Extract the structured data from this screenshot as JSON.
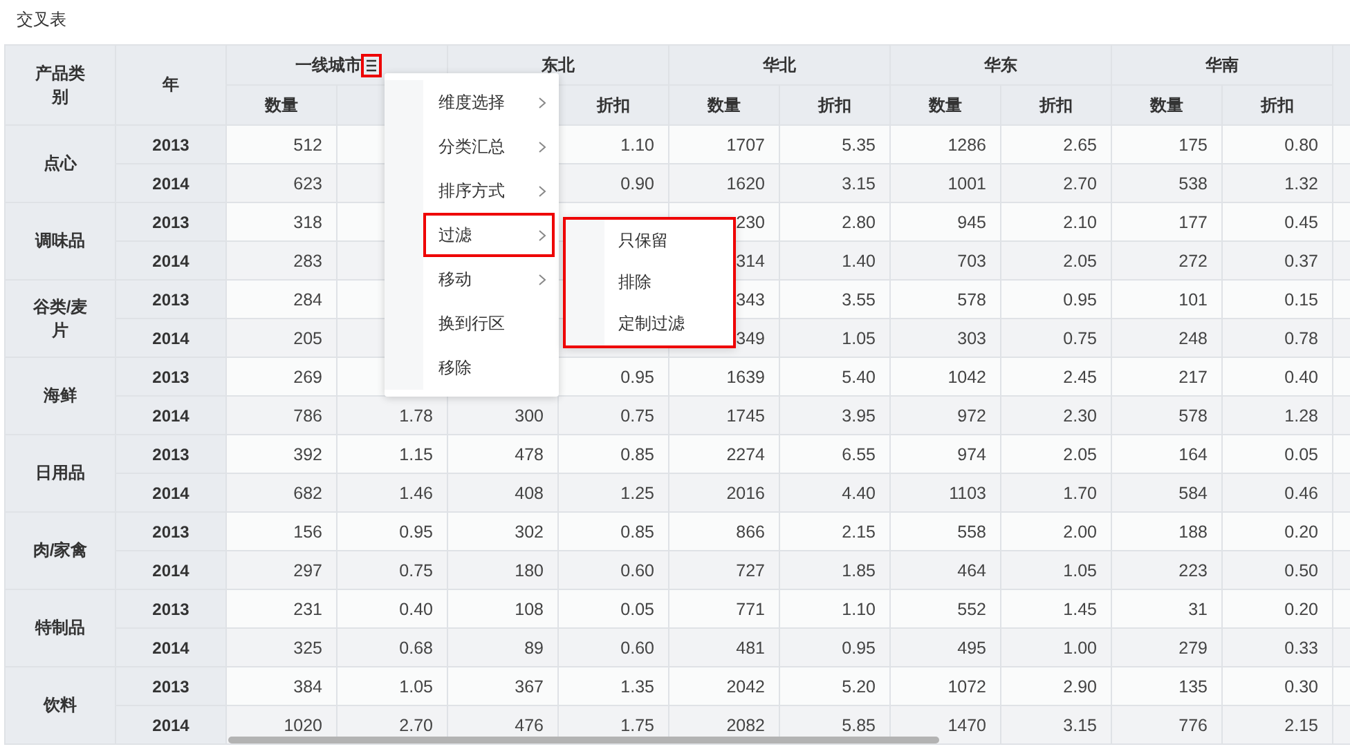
{
  "title": "交叉表",
  "table": {
    "corner_headers": [
      "产品类别",
      "年"
    ],
    "column_groups": [
      {
        "name": "一线城市",
        "menu_icon": {
          "highlighted": true
        },
        "subcolumns": {
          "quantity": "数量"
        }
      },
      {
        "name": "东北",
        "subcolumns": {
          "discount": "折扣"
        }
      },
      {
        "name": "华北",
        "subcolumns": {
          "quantity": "数量",
          "discount": "折扣"
        }
      },
      {
        "name": "华东",
        "subcolumns": {
          "quantity": "数量",
          "discount": "折扣"
        }
      },
      {
        "name": "华南",
        "subcolumns": {
          "quantity": "数量",
          "discount": "折扣"
        }
      }
    ],
    "rows": [
      {
        "category": "点心",
        "years": [
          {
            "year": "2013",
            "cells": {
              "column_1": "512",
              "column_4": "1.10",
              "column_5": "1707",
              "column_6": "5.35",
              "column_7": "1286",
              "column_8": "2.65",
              "column_9": "175",
              "column_10": "0.80"
            }
          },
          {
            "year": "2014",
            "cells": {
              "column_1": "623",
              "column_4": "0.90",
              "column_5": "1620",
              "column_6": "3.15",
              "column_7": "1001",
              "column_8": "2.70",
              "column_9": "538",
              "column_10": "1.32"
            }
          }
        ]
      },
      {
        "category": "调味品",
        "years": [
          {
            "year": "2013",
            "cells": {
              "column_1": "318",
              "column_5": "230",
              "column_6": "2.80",
              "column_7": "945",
              "column_8": "2.10",
              "column_9": "177",
              "column_10": "0.45"
            }
          },
          {
            "year": "2014",
            "cells": {
              "column_1": "283",
              "column_5": "314",
              "column_6": "1.40",
              "column_7": "703",
              "column_8": "2.05",
              "column_9": "272",
              "column_10": "0.37"
            }
          }
        ]
      },
      {
        "category": "谷类/麦片",
        "years": [
          {
            "year": "2013",
            "cells": {
              "column_1": "284",
              "column_5": "343",
              "column_6": "3.55",
              "column_7": "578",
              "column_8": "0.95",
              "column_9": "101",
              "column_10": "0.15"
            }
          },
          {
            "year": "2014",
            "cells": {
              "column_1": "205",
              "column_5": "349",
              "column_6": "1.05",
              "column_7": "303",
              "column_8": "0.75",
              "column_9": "248",
              "column_10": "0.78"
            }
          }
        ]
      },
      {
        "category": "海鲜",
        "years": [
          {
            "year": "2013",
            "cells": {
              "column_1": "269",
              "column_4": "0.95",
              "column_5": "1639",
              "column_6": "5.40",
              "column_7": "1042",
              "column_8": "2.45",
              "column_9": "217",
              "column_10": "0.40"
            }
          },
          {
            "year": "2014",
            "cells": {
              "column_1": "786",
              "column_2": "1.78",
              "column_3": "300",
              "column_4": "0.75",
              "column_5": "1745",
              "column_6": "3.95",
              "column_7": "972",
              "column_8": "2.30",
              "column_9": "578",
              "column_10": "1.28"
            }
          }
        ]
      },
      {
        "category": "日用品",
        "years": [
          {
            "year": "2013",
            "cells": {
              "column_1": "392",
              "column_2": "1.15",
              "column_3": "478",
              "column_4": "0.85",
              "column_5": "2274",
              "column_6": "6.55",
              "column_7": "974",
              "column_8": "2.05",
              "column_9": "164",
              "column_10": "0.05"
            }
          },
          {
            "year": "2014",
            "cells": {
              "column_1": "682",
              "column_2": "1.46",
              "column_3": "408",
              "column_4": "1.25",
              "column_5": "2016",
              "column_6": "4.40",
              "column_7": "1103",
              "column_8": "1.70",
              "column_9": "584",
              "column_10": "0.46"
            }
          }
        ]
      },
      {
        "category": "肉/家禽",
        "years": [
          {
            "year": "2013",
            "cells": {
              "column_1": "156",
              "column_2": "0.95",
              "column_3": "302",
              "column_4": "0.85",
              "column_5": "866",
              "column_6": "2.15",
              "column_7": "558",
              "column_8": "2.00",
              "column_9": "188",
              "column_10": "0.20"
            }
          },
          {
            "year": "2014",
            "cells": {
              "column_1": "297",
              "column_2": "0.75",
              "column_3": "180",
              "column_4": "0.60",
              "column_5": "727",
              "column_6": "1.85",
              "column_7": "464",
              "column_8": "1.05",
              "column_9": "223",
              "column_10": "0.50"
            }
          }
        ]
      },
      {
        "category": "特制品",
        "years": [
          {
            "year": "2013",
            "cells": {
              "column_1": "231",
              "column_2": "0.40",
              "column_3": "108",
              "column_4": "0.05",
              "column_5": "771",
              "column_6": "1.10",
              "column_7": "552",
              "column_8": "1.45",
              "column_9": "31",
              "column_10": "0.20"
            }
          },
          {
            "year": "2014",
            "cells": {
              "column_1": "325",
              "column_2": "0.68",
              "column_3": "89",
              "column_4": "0.60",
              "column_5": "481",
              "column_6": "0.95",
              "column_7": "495",
              "column_8": "1.00",
              "column_9": "279",
              "column_10": "0.33"
            }
          }
        ]
      },
      {
        "category": "饮料",
        "years": [
          {
            "year": "2013",
            "cells": {
              "column_1": "384",
              "column_2": "1.05",
              "column_3": "367",
              "column_4": "1.35",
              "column_5": "2042",
              "column_6": "5.20",
              "column_7": "1072",
              "column_8": "2.90",
              "column_9": "135",
              "column_10": "0.30"
            }
          },
          {
            "year": "2014",
            "cells": {
              "column_1": "1020",
              "column_2": "2.70",
              "column_3": "476",
              "column_4": "1.75",
              "column_5": "2082",
              "column_6": "5.85",
              "column_7": "1470",
              "column_8": "3.15",
              "column_9": "776",
              "column_10": "2.15"
            }
          }
        ]
      }
    ]
  },
  "context_menu": {
    "items": [
      {
        "label": "维度选择",
        "has_submenu": true,
        "highlighted": false
      },
      {
        "label": "分类汇总",
        "has_submenu": true,
        "highlighted": false
      },
      {
        "label": "排序方式",
        "has_submenu": true,
        "highlighted": false
      },
      {
        "label": "过滤",
        "has_submenu": true,
        "highlighted": true
      },
      {
        "label": "移动",
        "has_submenu": true,
        "highlighted": false
      },
      {
        "label": "换到行区",
        "has_submenu": false,
        "highlighted": false
      },
      {
        "label": "移除",
        "has_submenu": false,
        "highlighted": false
      }
    ]
  },
  "submenu": {
    "highlighted": true,
    "items": [
      "只保留",
      "排除",
      "定制过滤"
    ]
  }
}
